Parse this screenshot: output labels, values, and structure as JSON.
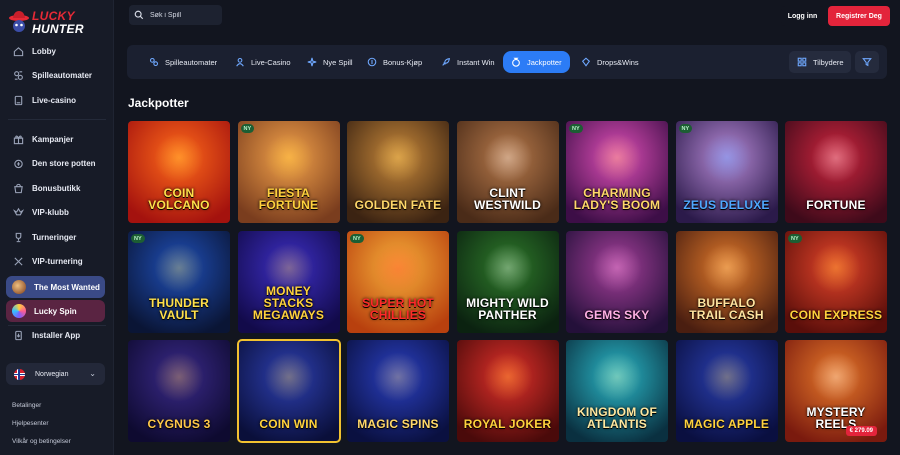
{
  "brand": {
    "line1": "LUCKY",
    "line2": "HUNTER"
  },
  "sidebar": {
    "primary": [
      {
        "label": "Lobby",
        "icon": "home-icon"
      },
      {
        "label": "Spilleautomater",
        "icon": "slots-icon"
      },
      {
        "label": "Live-casino",
        "icon": "live-casino-icon"
      }
    ],
    "secondary": [
      {
        "label": "Kampanjer",
        "icon": "gift-icon"
      },
      {
        "label": "Den store potten",
        "icon": "pot-icon"
      },
      {
        "label": "Bonusbutikk",
        "icon": "shop-icon"
      },
      {
        "label": "VIP-klubb",
        "icon": "vip-icon"
      },
      {
        "label": "Turneringer",
        "icon": "trophy-icon"
      },
      {
        "label": "VIP-turnering",
        "icon": "tournament-icon"
      }
    ],
    "promos": [
      {
        "label": "The Most Wanted"
      },
      {
        "label": "Lucky Spin"
      }
    ],
    "install": {
      "label": "Installer App",
      "icon": "install-app-icon"
    },
    "language": {
      "label": "Norwegian"
    },
    "footer_links": [
      "Betalinger",
      "Hjelpesenter",
      "Vilkår og betingelser"
    ]
  },
  "topbar": {
    "search_placeholder": "Søk i Spill",
    "login_label": "Logg inn",
    "register_label": "Registrer Deg"
  },
  "categories": {
    "items": [
      {
        "label": "Spilleautomater",
        "icon": "slots-icon",
        "active": false
      },
      {
        "label": "Live-Casino",
        "icon": "live-casino-icon",
        "active": false
      },
      {
        "label": "Nye Spill",
        "icon": "new-games-icon",
        "active": false
      },
      {
        "label": "Bonus-Kjøp",
        "icon": "bonus-buy-icon",
        "active": false
      },
      {
        "label": "Instant Win",
        "icon": "rocket-icon",
        "active": false
      },
      {
        "label": "Jackpotter",
        "icon": "jackpot-icon",
        "active": true
      },
      {
        "label": "Drops&Wins",
        "icon": "drops-icon",
        "active": false
      }
    ],
    "providers_label": "Tilbydere"
  },
  "section_title": "Jackpotter",
  "games": [
    {
      "name": "Coin Volcano",
      "new": false,
      "bg": [
        "#ff6a1a",
        "#a4120e"
      ],
      "fg": "#ffe04a"
    },
    {
      "name": "Fiesta Fortune",
      "new": true,
      "bg": [
        "#f3a24a",
        "#7a3d1e"
      ],
      "fg": "#ffd23d"
    },
    {
      "name": "Golden Fate",
      "new": false,
      "bg": [
        "#c9893a",
        "#3b2312"
      ],
      "fg": "#ffd86a"
    },
    {
      "name": "Clint Westwild",
      "new": false,
      "bg": [
        "#b87a4b",
        "#4a2b18"
      ],
      "fg": "#ffffff"
    },
    {
      "name": "Charming Lady's Boom",
      "new": true,
      "bg": [
        "#e04fb8",
        "#3d0e47"
      ],
      "fg": "#ffd86a"
    },
    {
      "name": "Zeus Deluxe",
      "new": true,
      "bg": [
        "#b78ad6",
        "#2b1a4a"
      ],
      "fg": "#4fa8ff"
    },
    {
      "name": "Fortune",
      "new": false,
      "bg": [
        "#d0253e",
        "#3e0a1a"
      ],
      "fg": "#ffffff"
    },
    {
      "name": "Thunder Vault",
      "new": true,
      "bg": [
        "#1f4fb8",
        "#0a1535"
      ],
      "fg": "#ffe04a"
    },
    {
      "name": "Money Stacks Megaways",
      "new": false,
      "bg": [
        "#3d2fc4",
        "#120a4a"
      ],
      "fg": "#ffd23d"
    },
    {
      "name": "Super Hot Chillies",
      "new": true,
      "bg": [
        "#f7b03a",
        "#b8400e"
      ],
      "fg": "#ff2a2a"
    },
    {
      "name": "Mighty Wild Panther",
      "new": false,
      "bg": [
        "#2e7a2a",
        "#0b2210"
      ],
      "fg": "#ffffff"
    },
    {
      "name": "Gems Sky",
      "new": false,
      "bg": [
        "#a63f9a",
        "#24103a"
      ],
      "fg": "#ffb0e4"
    },
    {
      "name": "Buffalo Trail Cash",
      "new": false,
      "bg": [
        "#e0782a",
        "#4a1e10"
      ],
      "fg": "#ffe4a0"
    },
    {
      "name": "Coin Express",
      "new": true,
      "bg": [
        "#e3442a",
        "#5a0e0a"
      ],
      "fg": "#ffd23d"
    },
    {
      "name": "Cygnus 3",
      "new": false,
      "bg": [
        "#3a2a8a",
        "#0e0a30"
      ],
      "fg": "#ffc84a"
    },
    {
      "name": "Coin Win",
      "new": false,
      "bg": [
        "#2d3fb0",
        "#0a0f3a"
      ],
      "fg": "#ffd23d"
    },
    {
      "name": "Magic Spins",
      "new": false,
      "bg": [
        "#2a3fc0",
        "#0a1040"
      ],
      "fg": "#ffd86a"
    },
    {
      "name": "Royal Joker",
      "new": false,
      "bg": [
        "#e0302a",
        "#4a0a0a"
      ],
      "fg": "#ffd23d"
    },
    {
      "name": "Kingdom of Atlantis",
      "new": false,
      "bg": [
        "#2ab8c8",
        "#0a3040"
      ],
      "fg": "#ffe8a0"
    },
    {
      "name": "Magic Apple",
      "new": false,
      "bg": [
        "#2a3fb0",
        "#0a0f40"
      ],
      "fg": "#ffd23d"
    },
    {
      "name": "Mystery Reels",
      "new": false,
      "bg": [
        "#e87a2a",
        "#7a1a0e"
      ],
      "fg": "#ffffff",
      "jackpot": "€ 279.09"
    }
  ]
}
